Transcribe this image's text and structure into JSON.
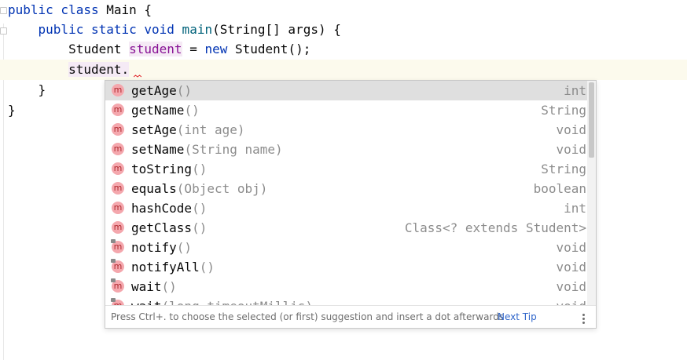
{
  "code": {
    "line1": {
      "kw": "public class",
      "name": " Main {"
    },
    "line2": {
      "indent": "    ",
      "kw": "public static void",
      "fn": " main",
      "rest": "(String[] args) {"
    },
    "line3": {
      "indent": "        ",
      "type": "Student ",
      "var": "student",
      "eq": " = ",
      "kw": "new",
      "rest": " Student();"
    },
    "line4": {
      "indent": "        ",
      "text": "student."
    },
    "line5": {
      "text": "    }"
    },
    "line6": {
      "text": "}"
    }
  },
  "completion": {
    "items": [
      {
        "name": "getAge",
        "params": "()",
        "type": "int",
        "icon": "method-icon",
        "selected": true
      },
      {
        "name": "getName",
        "params": "()",
        "type": "String",
        "icon": "method-icon"
      },
      {
        "name": "setAge",
        "params": "(int age)",
        "type": "void",
        "icon": "method-icon"
      },
      {
        "name": "setName",
        "params": "(String name)",
        "type": "void",
        "icon": "method-icon"
      },
      {
        "name": "toString",
        "params": "()",
        "type": "String",
        "icon": "method-icon"
      },
      {
        "name": "equals",
        "params": "(Object obj)",
        "type": "boolean",
        "icon": "method-icon"
      },
      {
        "name": "hashCode",
        "params": "()",
        "type": "int",
        "icon": "method-icon"
      },
      {
        "name": "getClass",
        "params": "()",
        "type": "Class<? extends Student>",
        "icon": "method-icon"
      },
      {
        "name": "notify",
        "params": "()",
        "type": "void",
        "icon": "final-method-icon"
      },
      {
        "name": "notifyAll",
        "params": "()",
        "type": "void",
        "icon": "final-method-icon"
      },
      {
        "name": "wait",
        "params": "()",
        "type": "void",
        "icon": "final-method-icon"
      },
      {
        "name": "wait",
        "params": "(long timeoutMillis)",
        "type": "void",
        "icon": "final-method-icon"
      }
    ],
    "icon_letter": "m",
    "footer": {
      "hint": "Press Ctrl+. to choose the selected (or first) suggestion and insert a dot afterwards",
      "next_tip": "Next Tip",
      "more_icon": "vertical-ellipsis-icon"
    }
  },
  "colors": {
    "keyword": "#0033b3",
    "method": "#00627a",
    "variable": "#871094",
    "selection": "#dfdfdf",
    "link": "#2f65ca",
    "error_squiggle": "#e0242b"
  }
}
